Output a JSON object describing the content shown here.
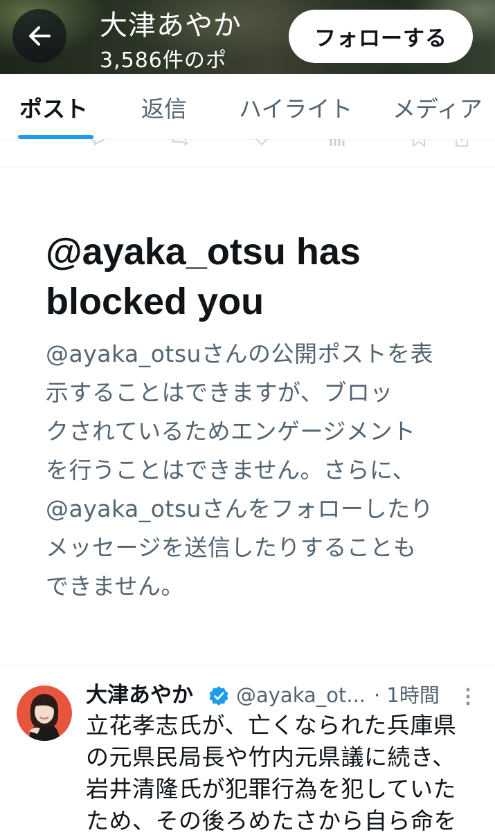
{
  "header": {
    "title": "大津あやか",
    "subtitle": "3,586件のポ",
    "back_icon": "arrow-left-icon",
    "follow_label": "フォローする"
  },
  "tabs": [
    {
      "label": "ポスト",
      "active": true
    },
    {
      "label": "返信",
      "active": false
    },
    {
      "label": "ハイライト",
      "active": false
    },
    {
      "label": "メディア",
      "active": false
    }
  ],
  "blocked": {
    "title_line1": "@ayaka_otsu has",
    "title_line2": "blocked you",
    "body_lines": [
      "@ayaka_otsuさんの公開ポストを表",
      "示することはできますが、ブロッ",
      "クされているためエンゲージメント",
      "を行うことはできません。さらに、",
      "@ayaka_otsuさんをフォローしたり",
      "メッセージを送信したりすることも",
      "できません。"
    ]
  },
  "post": {
    "author": "大津あやか",
    "verified_icon": "verified-badge-icon",
    "handle": "@ayaka_ot...",
    "time": "· 1時間",
    "text_lines": [
      "立花孝志氏が、亡くなられた兵庫県",
      "の元県民局長や竹内元県議に続き、",
      "岩井清隆氏が犯罪行為を犯していた",
      "ため、その後ろめたさから自ら命を"
    ]
  },
  "colors": {
    "accent": "#1d9bf0",
    "text_primary": "#0f1419",
    "text_secondary": "#536471",
    "divider": "#eff3f4"
  }
}
